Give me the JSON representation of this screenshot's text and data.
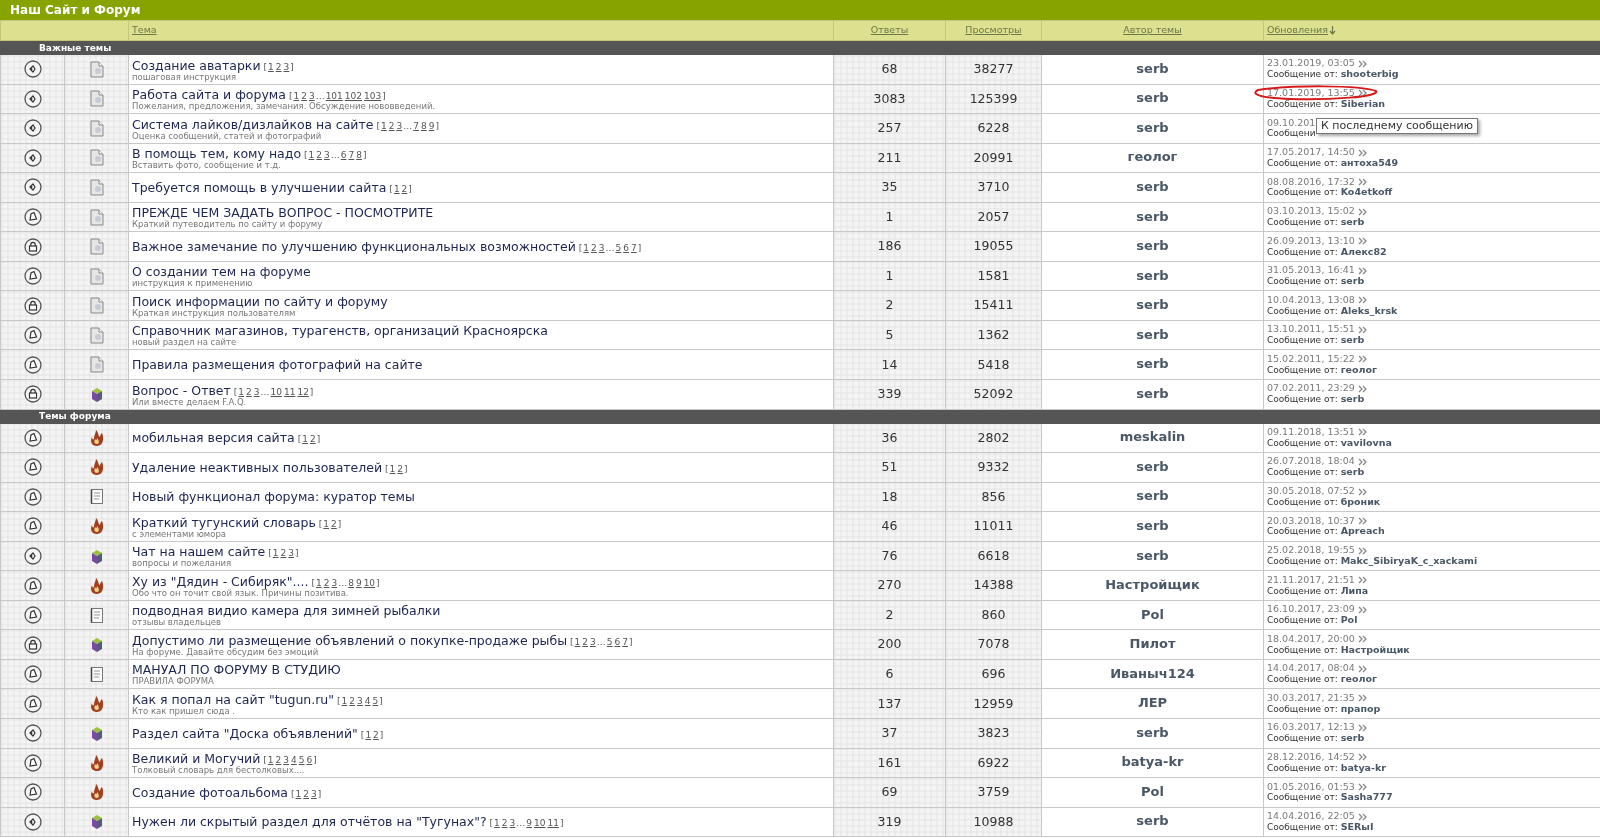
{
  "title": "Наш Сайт и Форум",
  "columns": [
    {
      "label": "Тема",
      "sorted": false
    },
    {
      "label": "Ответы",
      "sorted": false
    },
    {
      "label": "Просмотры",
      "sorted": false
    },
    {
      "label": "Автор темы",
      "sorted": false
    },
    {
      "label": "Обновления",
      "sorted": true
    }
  ],
  "sections": [
    {
      "label": "Важные темы",
      "topics": [
        {
          "status_icon": {
            "kind": "dot"
          },
          "type_icon": {
            "kind": "doc"
          },
          "title": "Создание аватарки",
          "pages": {
            "open": "[",
            "links": [
              "1",
              "2",
              "3"
            ],
            "close": "]"
          },
          "subtitle": "пошаговая инструкция",
          "replies": "68",
          "views": "38277",
          "author": "serb",
          "last_date": "23.01.2019, 03:05",
          "last_by_label": "Сообщение от:",
          "last_by": "shooterbig",
          "circled": false
        },
        {
          "status_icon": {
            "kind": "dot"
          },
          "type_icon": {
            "kind": "doc"
          },
          "title": "Работа сайта и форума",
          "pages": {
            "open": "[",
            "links": [
              "1",
              "2",
              "3"
            ],
            "gap": "…",
            "tail": [
              "101",
              "102",
              "103"
            ],
            "close": "]"
          },
          "subtitle": "Пожелания, предложения, замечания. Обсуждение нововведений.",
          "replies": "3083",
          "views": "125399",
          "author": "serb",
          "last_date": "17.01.2019, 13:55",
          "last_by_label": "Сообщение от:",
          "last_by": "Siberian",
          "circled": true
        },
        {
          "status_icon": {
            "kind": "dot"
          },
          "type_icon": {
            "kind": "doc"
          },
          "title": "Система лайков/дизлайков на сайте",
          "pages": {
            "open": "[",
            "links": [
              "1",
              "2",
              "3"
            ],
            "gap": "…",
            "tail": [
              "7",
              "8",
              "9"
            ],
            "close": "]"
          },
          "subtitle": "Оценка сообщений, статей и фотографий",
          "replies": "257",
          "views": "6228",
          "author": "serb",
          "last_date": "09.10.201",
          "last_by_label": "Сообщени",
          "tooltip": "К последнему сообщению",
          "circled": false
        },
        {
          "status_icon": {
            "kind": "dot"
          },
          "type_icon": {
            "kind": "doc"
          },
          "title": "В помощь тем, кому надо",
          "pages": {
            "open": "[",
            "links": [
              "1",
              "2",
              "3"
            ],
            "gap": "…",
            "tail": [
              "6",
              "7",
              "8"
            ],
            "close": "]"
          },
          "subtitle": "Вставить фото, сообщение и т.д.",
          "replies": "211",
          "views": "20991",
          "author": "геолог",
          "last_date": "17.05.2017, 14:50",
          "last_by_label": "Сообщение от:",
          "last_by": "антоха549",
          "circled": false
        },
        {
          "status_icon": {
            "kind": "dot"
          },
          "type_icon": {
            "kind": "doc"
          },
          "title": "Требуется помощь в улучшении сайта",
          "pages": {
            "open": "[",
            "links": [
              "1",
              "2"
            ],
            "close": "]"
          },
          "replies": "35",
          "views": "3710",
          "author": "serb",
          "last_date": "08.08.2016, 17:32",
          "last_by_label": "Сообщение от:",
          "last_by": "Ko4etkoff",
          "circled": false
        },
        {
          "status_icon": {
            "kind": "bell"
          },
          "type_icon": {
            "kind": "doc"
          },
          "title": "ПРЕЖДЕ ЧЕМ ЗАДАТЬ ВОПРОС - ПОСМОТРИТЕ",
          "subtitle": "Краткий путеводитель по сайту и форуму",
          "replies": "1",
          "views": "2057",
          "author": "serb",
          "last_date": "03.10.2013, 15:02",
          "last_by_label": "Сообщение от:",
          "last_by": "serb",
          "circled": false
        },
        {
          "status_icon": {
            "kind": "lock"
          },
          "type_icon": {
            "kind": "doc"
          },
          "title": "Важное замечание по улучшению функциональных возможностей",
          "pages": {
            "open": "[",
            "links": [
              "1",
              "2",
              "3"
            ],
            "gap": "…",
            "tail": [
              "5",
              "6",
              "7"
            ],
            "close": "]"
          },
          "replies": "186",
          "views": "19055",
          "author": "serb",
          "last_date": "26.09.2013, 13:10",
          "last_by_label": "Сообщение от:",
          "last_by": "Алекс82",
          "circled": false
        },
        {
          "status_icon": {
            "kind": "bell"
          },
          "type_icon": {
            "kind": "doc"
          },
          "title": "О создании тем на форуме",
          "subtitle": "инструкция к применению",
          "replies": "1",
          "views": "1581",
          "author": "serb",
          "last_date": "31.05.2013, 16:41",
          "last_by_label": "Сообщение от:",
          "last_by": "serb",
          "circled": false
        },
        {
          "status_icon": {
            "kind": "lock"
          },
          "type_icon": {
            "kind": "doc"
          },
          "title": "Поиск информации по сайту и форуму",
          "subtitle": "Краткая инструкция пользователям",
          "replies": "2",
          "views": "15411",
          "author": "serb",
          "last_date": "10.04.2013, 13:08",
          "last_by_label": "Сообщение от:",
          "last_by": "Aleks_krsk",
          "circled": false
        },
        {
          "status_icon": {
            "kind": "bell"
          },
          "type_icon": {
            "kind": "doc"
          },
          "title": "Справочник магазинов, турагенств, организаций Красноярска",
          "subtitle": "новый раздел на сайте",
          "replies": "5",
          "views": "1362",
          "author": "serb",
          "last_date": "13.10.2011, 15:51",
          "last_by_label": "Сообщение от:",
          "last_by": "serb",
          "circled": false
        },
        {
          "status_icon": {
            "kind": "bell"
          },
          "type_icon": {
            "kind": "doc"
          },
          "title": "Правила размещения фотографий на сайте",
          "replies": "14",
          "views": "5418",
          "author": "serb",
          "last_date": "15.02.2011, 15:22",
          "last_by_label": "Сообщение от:",
          "last_by": "геолог",
          "circled": false
        },
        {
          "status_icon": {
            "kind": "lock"
          },
          "type_icon": {
            "kind": "cube"
          },
          "title": "Вопрос - Ответ",
          "pages": {
            "open": "[",
            "links": [
              "1",
              "2",
              "3"
            ],
            "gap": "…",
            "tail": [
              "10",
              "11",
              "12"
            ],
            "close": "]"
          },
          "subtitle": "Или вместе делаем F.A.Q.",
          "replies": "339",
          "views": "52092",
          "author": "serb",
          "last_date": "07.02.2011, 23:29",
          "last_by_label": "Сообщение от:",
          "last_by": "serb",
          "circled": false
        }
      ]
    },
    {
      "label": "Темы форума",
      "topics": [
        {
          "status_icon": {
            "kind": "bell"
          },
          "type_icon": {
            "kind": "flame"
          },
          "title": "мобильная версия сайта",
          "pages": {
            "open": "[",
            "links": [
              "1",
              "2"
            ],
            "close": "]"
          },
          "replies": "36",
          "views": "2802",
          "author": "meskalin",
          "last_date": "09.11.2018, 13:51",
          "last_by_label": "Сообщение от:",
          "last_by": "vavilovna",
          "circled": false
        },
        {
          "status_icon": {
            "kind": "bell"
          },
          "type_icon": {
            "kind": "flame"
          },
          "title": "Удаление неактивных пользователей",
          "pages": {
            "open": "[",
            "links": [
              "1",
              "2"
            ],
            "close": "]"
          },
          "replies": "51",
          "views": "9332",
          "author": "serb",
          "last_date": "26.07.2018, 18:04",
          "last_by_label": "Сообщение от:",
          "last_by": "serb",
          "circled": false
        },
        {
          "status_icon": {
            "kind": "bell"
          },
          "type_icon": {
            "kind": "note"
          },
          "title": "Новый функционал форума: куратор темы",
          "replies": "18",
          "views": "856",
          "author": "serb",
          "last_date": "30.05.2018, 07:52",
          "last_by_label": "Сообщение от:",
          "last_by": "броник",
          "circled": false
        },
        {
          "status_icon": {
            "kind": "bell"
          },
          "type_icon": {
            "kind": "flame"
          },
          "title": "Краткий тугунский словарь",
          "pages": {
            "open": "[",
            "links": [
              "1",
              "2"
            ],
            "close": "]"
          },
          "subtitle": "с элементами юмора",
          "replies": "46",
          "views": "11011",
          "author": "serb",
          "last_date": "20.03.2018, 10:37",
          "last_by_label": "Сообщение от:",
          "last_by": "Apreach",
          "circled": false
        },
        {
          "status_icon": {
            "kind": "dot"
          },
          "type_icon": {
            "kind": "cube"
          },
          "title": "Чат на нашем сайте",
          "pages": {
            "open": "[",
            "links": [
              "1",
              "2",
              "3"
            ],
            "close": "]"
          },
          "subtitle": "вопросы и пожелания",
          "replies": "76",
          "views": "6618",
          "author": "serb",
          "last_date": "25.02.2018, 19:55",
          "last_by_label": "Сообщение от:",
          "last_by": "Makc_SibiryaK_c_xackami",
          "circled": false
        },
        {
          "status_icon": {
            "kind": "bell"
          },
          "type_icon": {
            "kind": "flame"
          },
          "title": "Ху из \"Дядин - Сибиряк\"....",
          "pages": {
            "open": "[",
            "links": [
              "1",
              "2",
              "3"
            ],
            "gap": "…",
            "tail": [
              "8",
              "9",
              "10"
            ],
            "close": "]"
          },
          "subtitle": "Обо что он точит свой язык. Причины позитива.",
          "replies": "270",
          "views": "14388",
          "author": "Настройщик",
          "last_date": "21.11.2017, 21:51",
          "last_by_label": "Сообщение от:",
          "last_by": "Липа",
          "circled": false
        },
        {
          "status_icon": {
            "kind": "bell"
          },
          "type_icon": {
            "kind": "note"
          },
          "title": "подводная видио камера для зимней рыбалки",
          "subtitle": "отзывы владельцев",
          "replies": "2",
          "views": "860",
          "author": "Pol",
          "last_date": "16.10.2017, 23:09",
          "last_by_label": "Сообщение от:",
          "last_by": "Pol",
          "circled": false
        },
        {
          "status_icon": {
            "kind": "lock"
          },
          "type_icon": {
            "kind": "cube"
          },
          "title": "Допустимо ли размещение объявлений о покупке-продаже рыбы",
          "pages": {
            "open": "[",
            "links": [
              "1",
              "2",
              "3"
            ],
            "gap": "…",
            "tail": [
              "5",
              "6",
              "7"
            ],
            "close": "]"
          },
          "subtitle": "На форуме. Давайте обсудим без эмоций",
          "replies": "200",
          "views": "7078",
          "author": "Пилот",
          "last_date": "18.04.2017, 20:00",
          "last_by_label": "Сообщение от:",
          "last_by": "Настройщик",
          "circled": false
        },
        {
          "status_icon": {
            "kind": "bell"
          },
          "type_icon": {
            "kind": "note"
          },
          "title": "МАНУАЛ ПО ФОРУМУ В СТУДИЮ",
          "subtitle": "ПРАВИЛА ФОРУМА",
          "replies": "6",
          "views": "696",
          "author": "Иваныч124",
          "last_date": "14.04.2017, 08:04",
          "last_by_label": "Сообщение от:",
          "last_by": "геолог",
          "circled": false
        },
        {
          "status_icon": {
            "kind": "bell"
          },
          "type_icon": {
            "kind": "flame"
          },
          "title": "Как я попал на сайт \"tugun.ru\"",
          "pages": {
            "open": "[",
            "links": [
              "1",
              "2",
              "3",
              "4",
              "5"
            ],
            "close": "]"
          },
          "subtitle": "Кто как пришел сюда .",
          "replies": "137",
          "views": "12959",
          "author": "ЛЕР",
          "last_date": "30.03.2017, 21:35",
          "last_by_label": "Сообщение от:",
          "last_by": "прапор",
          "circled": false
        },
        {
          "status_icon": {
            "kind": "dot"
          },
          "type_icon": {
            "kind": "cube"
          },
          "title": "Раздел сайта \"Доска объявлений\"",
          "pages": {
            "open": "[",
            "links": [
              "1",
              "2"
            ],
            "close": "]"
          },
          "replies": "37",
          "views": "3823",
          "author": "serb",
          "last_date": "16.03.2017, 12:13",
          "last_by_label": "Сообщение от:",
          "last_by": "serb",
          "circled": false
        },
        {
          "status_icon": {
            "kind": "bell"
          },
          "type_icon": {
            "kind": "flame"
          },
          "title": "Великий и Могучий",
          "pages": {
            "open": "[",
            "links": [
              "1",
              "2",
              "3",
              "4",
              "5",
              "6"
            ],
            "close": "]"
          },
          "subtitle": "Толковый словарь для бестолковых....",
          "replies": "161",
          "views": "6922",
          "author": "batya-kr",
          "last_date": "28.12.2016, 14:52",
          "last_by_label": "Сообщение от:",
          "last_by": "batya-kr",
          "circled": false
        },
        {
          "status_icon": {
            "kind": "bell"
          },
          "type_icon": {
            "kind": "flame"
          },
          "title": "Создание фотоальбома",
          "pages": {
            "open": "[",
            "links": [
              "1",
              "2",
              "3"
            ],
            "close": "]"
          },
          "replies": "69",
          "views": "3759",
          "author": "Pol",
          "last_date": "01.05.2016, 01:53",
          "last_by_label": "Сообщение от:",
          "last_by": "Sasha777",
          "circled": false
        },
        {
          "status_icon": {
            "kind": "dot"
          },
          "type_icon": {
            "kind": "cube"
          },
          "title": "Нужен ли скрытый раздел для отчётов на \"Тугунах\"?",
          "pages": {
            "open": "[",
            "links": [
              "1",
              "2",
              "3"
            ],
            "gap": "…",
            "tail": [
              "9",
              "10",
              "11"
            ],
            "close": "]"
          },
          "replies": "319",
          "views": "10988",
          "author": "serb",
          "last_date": "14.04.2016, 22:05",
          "last_by_label": "Сообщение от:",
          "last_by": "SERыI",
          "circled": false
        }
      ]
    }
  ]
}
